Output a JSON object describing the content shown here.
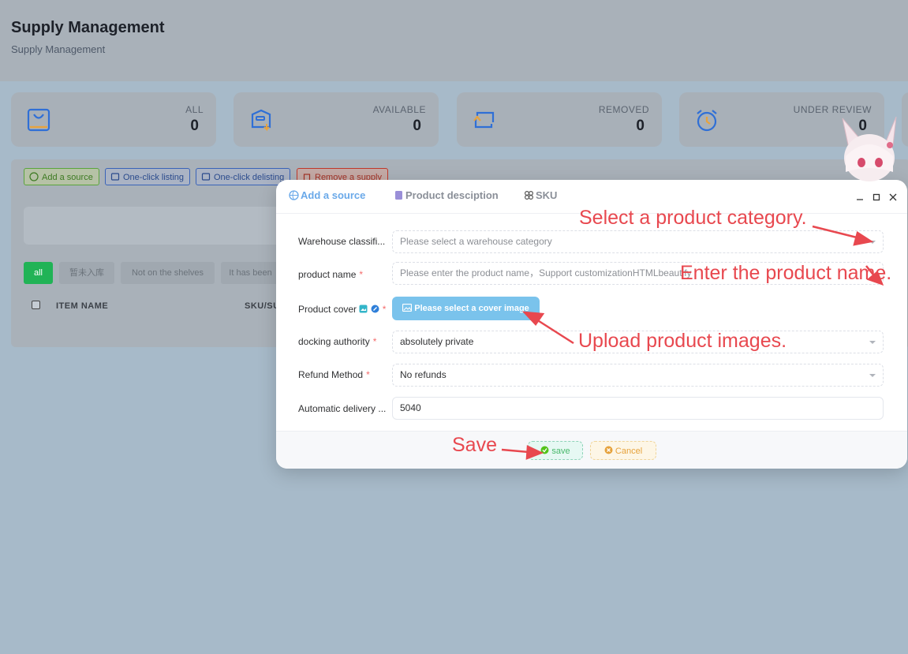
{
  "header": {
    "title": "Supply Management",
    "breadcrumb": "Supply Management"
  },
  "stats": [
    {
      "label": "ALL",
      "value": "0",
      "icon": "bag-icon"
    },
    {
      "label": "AVAILABLE",
      "value": "0",
      "icon": "box-arrow-icon"
    },
    {
      "label": "REMOVED",
      "value": "0",
      "icon": "refresh-icon"
    },
    {
      "label": "UNDER REVIEW",
      "value": "0",
      "icon": "alarm-clock-icon"
    }
  ],
  "toolbar": {
    "add_source": "Add a source",
    "one_click_listing": "One-click listing",
    "one_click_delisting": "One-click delisting",
    "remove_supply": "Remove a supply"
  },
  "filters": [
    "all",
    "暂未入库",
    "Not on the shelves",
    "It has been"
  ],
  "table": {
    "columns": [
      "ITEM NAME",
      "SKU/SU"
    ]
  },
  "dialog": {
    "tabs": [
      "Add a source",
      "Product desciption",
      "SKU"
    ],
    "fields": {
      "warehouse": {
        "label": "Warehouse classifi...",
        "placeholder": "Please select a warehouse category"
      },
      "product_name": {
        "label": "product name",
        "placeholder": "Please enter the product name，Support customizationHTMLbeautify"
      },
      "cover": {
        "label": "Product cover",
        "button": "Please select a cover image"
      },
      "docking": {
        "label": "docking authority",
        "value": "absolutely private"
      },
      "refund": {
        "label": "Refund Method",
        "value": "No refunds"
      },
      "auto_delivery": {
        "label": "Automatic delivery ...",
        "value": "5040"
      }
    },
    "save_label": "save",
    "cancel_label": "Cancel"
  },
  "annotations": {
    "category": "Select a product category.",
    "name": "Enter the product name.",
    "images": "Upload product images.",
    "save": "Save"
  },
  "colors": {
    "accent": "#6aa9e9",
    "danger": "#f56c6c",
    "annotation": "#e8484f",
    "save": "#52c41a",
    "cancel": "#e6a23c"
  }
}
